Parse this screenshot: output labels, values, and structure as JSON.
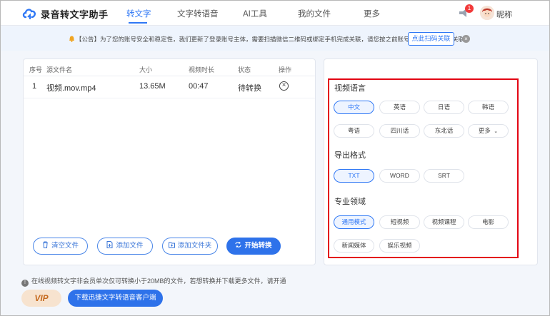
{
  "header": {
    "app_title": "录音转文字助手",
    "nav": [
      "转文字",
      "文字转语音",
      "AI工具",
      "我的文件",
      "更多"
    ],
    "notification_count": "1",
    "nickname": "昵称",
    "accent": "#2e77f5"
  },
  "notice": {
    "text": "【公告】为了您的账号安全和稳定性，我们更新了登录账号主体，需要扫描微信二维码或绑定手机完成关联，请您按之前账号的登录方式进行关联。",
    "button": "点此扫码关联"
  },
  "file_table": {
    "headers": [
      "序号",
      "源文件名",
      "大小",
      "视频时长",
      "状态",
      "操作"
    ],
    "rows": [
      {
        "index": "1",
        "name": "视频.mov.mp4",
        "size": "13.65M",
        "duration": "00:47",
        "status": "待转换"
      }
    ]
  },
  "actions": {
    "clear": "清空文件",
    "add_file": "添加文件",
    "add_folder": "添加文件夹",
    "start": "开始转换"
  },
  "settings": {
    "language_title": "视频语言",
    "languages": [
      "中文",
      "英语",
      "日语",
      "韩语",
      "粤语",
      "四川话",
      "东北话",
      "更多"
    ],
    "selected_language": "中文",
    "format_title": "导出格式",
    "formats": [
      "TXT",
      "WORD",
      "SRT"
    ],
    "selected_format": "TXT",
    "domain_title": "专业领域",
    "domains": [
      "通用模式",
      "短视频",
      "视频课程",
      "电影",
      "新闻媒体",
      "娱乐视频"
    ],
    "selected_domain": "通用模式",
    "highlight_color": "#e30613"
  },
  "footer": {
    "info": "在线视频转文字非会员单次仅可转换小于20MB的文件，若想转换并下载更多文件，请开通",
    "vip": "VIP",
    "download": "下载迅捷文字转语音客户端"
  }
}
